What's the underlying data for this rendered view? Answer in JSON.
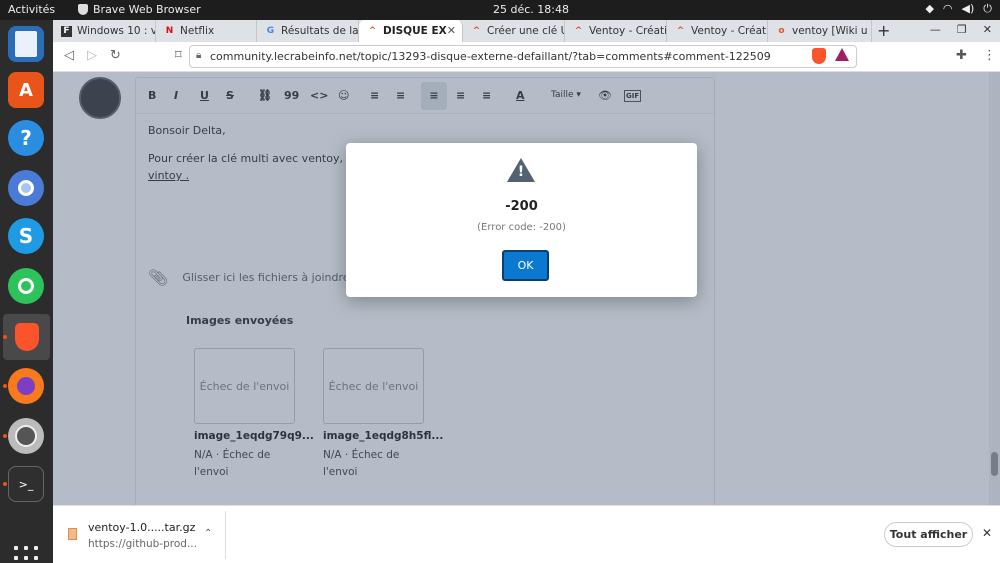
{
  "topbar": {
    "activities": "Activités",
    "app_name": "Brave Web Browser",
    "clock": "25 déc.  18:48"
  },
  "dock": {
    "items": [
      "files-icon",
      "software-icon",
      "help-icon",
      "chromium-icon",
      "skype-icon",
      "whatsapp-icon",
      "brave-icon",
      "firefox-icon",
      "disk-icon",
      "terminal-icon",
      "app-grid-icon"
    ]
  },
  "tabs": [
    {
      "label": "Windows 10 : v",
      "favicon": "F"
    },
    {
      "label": "Netflix",
      "favicon": "N"
    },
    {
      "label": "Résultats de la",
      "favicon": "G"
    },
    {
      "label": "DISQUE EX",
      "favicon": "^"
    },
    {
      "label": "Créer une clé U",
      "favicon": "^"
    },
    {
      "label": "Ventoy - Créati",
      "favicon": "^"
    },
    {
      "label": "Ventoy - Créati",
      "favicon": "^"
    },
    {
      "label": "ventoy [Wiki u",
      "favicon": "o"
    }
  ],
  "address_bar": {
    "url": "community.lecrabeinfo.net/topic/13293-disque-externe-defaillant/?tab=comments#comment-122509"
  },
  "editor": {
    "toolbar": [
      "B",
      "I",
      "U",
      "S",
      "⛓",
      "99",
      "<>",
      "☺",
      "≡",
      "≡",
      "≡",
      "≡",
      "≡",
      "A",
      "Taille ▾",
      "👁",
      "GIF"
    ],
    "line1": "Bonsoir Delta,",
    "line2": "Pour créer la clé multi avec ventoy, je c",
    "line3": "vintoy .",
    "attach_text": "Glisser ici les fichiers à joindre, o",
    "images_title": "Images envoyées",
    "images": [
      {
        "card": "Échec de l'envoi",
        "name": "image_1eqdg79q9...",
        "status": "N/A · Échec de l'envoi"
      },
      {
        "card": "Échec de l'envoi",
        "name": "image_1eqdg8h5fl...",
        "status": "N/A · Échec de l'envoi"
      }
    ]
  },
  "dialog": {
    "title": "-200",
    "subtitle": "(Error code: -200)",
    "ok_label": "OK"
  },
  "download": {
    "filename": "ventoy-1.0.....tar.gz",
    "source": "https://github-prod...",
    "show_all": "Tout afficher"
  }
}
